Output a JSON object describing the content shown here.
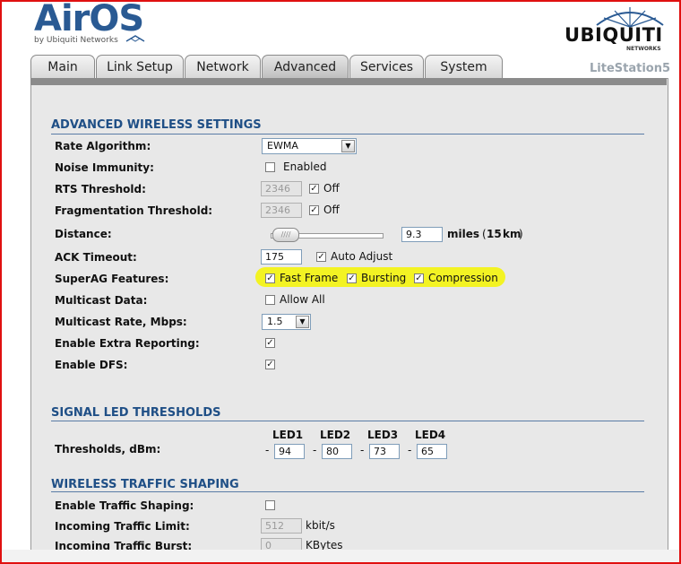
{
  "brand": {
    "logo": "AirOS",
    "tm": "™",
    "by": "by Ubiquiti Networks",
    "company": "UBIQUITI",
    "company_sub": "NETWORKS",
    "device": "LiteStation5"
  },
  "tabs": [
    {
      "label": "Main"
    },
    {
      "label": "Link Setup"
    },
    {
      "label": "Network"
    },
    {
      "label": "Advanced",
      "active": true
    },
    {
      "label": "Services"
    },
    {
      "label": "System"
    }
  ],
  "advanced_wireless": {
    "title": "ADVANCED WIRELESS SETTINGS",
    "rate_algorithm": {
      "label": "Rate Algorithm:",
      "value": "EWMA"
    },
    "noise_immunity": {
      "label": "Noise Immunity:",
      "option": "Enabled"
    },
    "rts": {
      "label": "RTS Threshold:",
      "value": "2346",
      "option": "Off"
    },
    "frag": {
      "label": "Fragmentation Threshold:",
      "value": "2346",
      "option": "Off"
    },
    "distance": {
      "label": "Distance:",
      "value": "9.3",
      "unit_a": "miles",
      "paren_open": "(",
      "km": "15",
      "unit_b": "km",
      "paren_close": ")"
    },
    "ack": {
      "label": "ACK Timeout:",
      "value": "175",
      "option": "Auto Adjust"
    },
    "superag": {
      "label": "SuperAG Features:",
      "fast_frame": "Fast Frame",
      "bursting": "Bursting",
      "compression": "Compression"
    },
    "multicast_data": {
      "label": "Multicast Data:",
      "option": "Allow All"
    },
    "multicast_rate": {
      "label": "Multicast Rate, Mbps:",
      "value": "1.5"
    },
    "extra_reporting": {
      "label": "Enable Extra Reporting:"
    },
    "dfs": {
      "label": "Enable DFS:"
    }
  },
  "led": {
    "title": "SIGNAL LED THRESHOLDS",
    "label": "Thresholds, dBm:",
    "dash": "-",
    "heads": [
      "LED1",
      "LED2",
      "LED3",
      "LED4"
    ],
    "values": [
      "94",
      "80",
      "73",
      "65"
    ]
  },
  "shaping": {
    "title": "WIRELESS TRAFFIC SHAPING",
    "enable": {
      "label": "Enable Traffic Shaping:"
    },
    "incoming_limit": {
      "label": "Incoming Traffic Limit:",
      "value": "512",
      "unit": "kbit/s"
    },
    "incoming_burst": {
      "label": "Incoming Traffic Burst:",
      "value": "0",
      "unit": "KBytes"
    }
  }
}
